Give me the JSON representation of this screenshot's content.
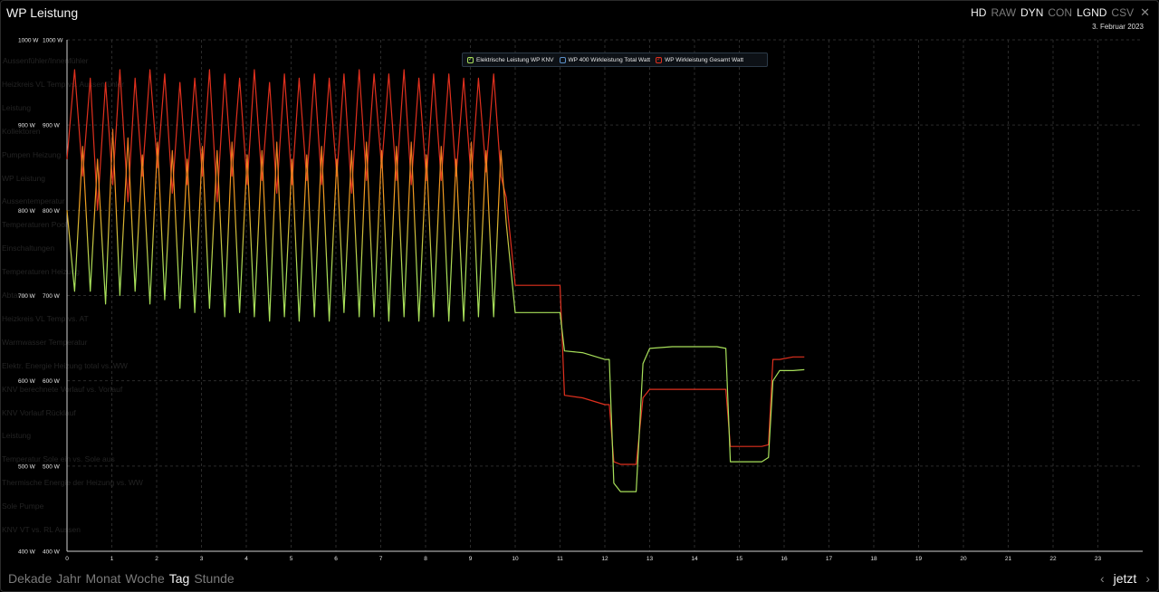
{
  "title": "WP Leistung",
  "top_buttons": [
    {
      "label": "HD",
      "active": true
    },
    {
      "label": "RAW",
      "active": false
    },
    {
      "label": "DYN",
      "active": true
    },
    {
      "label": "CON",
      "active": false
    },
    {
      "label": "LGND",
      "active": true
    },
    {
      "label": "CSV",
      "active": false
    }
  ],
  "close_icon": "close-icon",
  "date": "3. Februar 2023",
  "ghost_menu": [
    "Aussenfühler/Innenfühler",
    "Heizkreis VL Temp vs. Aussenfühler",
    "Leistung",
    "Kollektoren",
    "Pumpen Heizung",
    "WP Leistung",
    "Aussentemperatur",
    "Temperaturen Pool",
    "Einschaltungen",
    "Temperaturen Heizung",
    "Abtauen",
    "Heizkreis VL Temp vs. AT",
    "Warmwasser Temperatur",
    "Elektr. Energie Heizung total vs. WW",
    "KNV berechnete Vorlauf vs. Vorlauf",
    "KNV Vorlauf Rücklauf",
    "Leistung",
    "Temperatur Sole ein vs. Sole aus",
    "Thermische Energie der Heizung vs. WW",
    "Sole Pumpe",
    "KNV VT vs. RL Aussen"
  ],
  "legend": [
    {
      "name": "Elektrische Leistung WP KNV",
      "color": "#a8e05a",
      "checked": true
    },
    {
      "name": "WP 400 Wirkleistung Total Watt",
      "color": "#5b8fc7",
      "checked": false
    },
    {
      "name": "WP Wirkleistung Gesamt Watt",
      "color": "#e0301e",
      "checked": true
    }
  ],
  "bottom_nav": [
    {
      "label": "Dekade",
      "active": false
    },
    {
      "label": "Jahr",
      "active": false
    },
    {
      "label": "Monat",
      "active": false
    },
    {
      "label": "Woche",
      "active": false
    },
    {
      "label": "Tag",
      "active": true
    },
    {
      "label": "Stunde",
      "active": false
    }
  ],
  "nav": {
    "prev_icon": "chevron-left-icon",
    "now_label": "jetzt",
    "next_icon": "chevron-right-icon"
  },
  "chart_data": {
    "type": "line",
    "xlim": [
      0,
      24
    ],
    "ylim": [
      400,
      1000
    ],
    "x_ticks": [
      "0",
      "1",
      "2",
      "3",
      "4",
      "5",
      "6",
      "7",
      "8",
      "9",
      "10",
      "11",
      "12",
      "13",
      "14",
      "15",
      "16",
      "17",
      "18",
      "19",
      "20",
      "21",
      "22",
      "23"
    ],
    "y_ticks": [
      "1000 W",
      "900 W",
      "800 W",
      "700 W",
      "600 W",
      "500 W",
      "400 W"
    ],
    "y_tick_values": [
      1000,
      900,
      800,
      700,
      600,
      500,
      400
    ],
    "grid": true,
    "legend_position": "top-center",
    "series": [
      {
        "name": "Elektrische Leistung WP KNV",
        "color": "#a8e05a",
        "gradient_top": "#e0301e",
        "x": [
          0,
          0.17,
          0.35,
          0.52,
          0.68,
          0.86,
          1.02,
          1.18,
          1.36,
          1.52,
          1.68,
          1.85,
          2.02,
          2.18,
          2.35,
          2.52,
          2.68,
          2.85,
          3.02,
          3.18,
          3.35,
          3.52,
          3.68,
          3.85,
          4.02,
          4.18,
          4.35,
          4.52,
          4.68,
          4.85,
          5.02,
          5.18,
          5.35,
          5.52,
          5.68,
          5.85,
          6.02,
          6.18,
          6.35,
          6.52,
          6.68,
          6.85,
          7.02,
          7.18,
          7.35,
          7.52,
          7.68,
          7.85,
          8.02,
          8.18,
          8.35,
          8.52,
          8.68,
          8.85,
          9.02,
          9.18,
          9.35,
          9.52,
          9.68,
          9.8,
          10,
          10.5,
          11,
          11.1,
          11.5,
          12,
          12.1,
          12.2,
          12.35,
          12.5,
          12.7,
          12.85,
          13,
          13.5,
          14,
          14.5,
          14.7,
          14.8,
          15.1,
          15.5,
          15.65,
          15.75,
          15.9,
          16.2,
          16.45
        ],
        "y": [
          800,
          705,
          875,
          705,
          860,
          690,
          895,
          700,
          885,
          705,
          865,
          690,
          880,
          695,
          870,
          685,
          860,
          680,
          875,
          685,
          870,
          675,
          880,
          680,
          865,
          675,
          870,
          670,
          880,
          675,
          860,
          670,
          865,
          675,
          875,
          670,
          860,
          680,
          870,
          675,
          880,
          675,
          870,
          670,
          875,
          675,
          880,
          670,
          865,
          675,
          875,
          670,
          860,
          670,
          880,
          675,
          870,
          675,
          870,
          785,
          680,
          680,
          680,
          635,
          633,
          625,
          625,
          480,
          470,
          470,
          470,
          620,
          638,
          640,
          640,
          640,
          638,
          505,
          505,
          505,
          510,
          600,
          612,
          612,
          613
        ]
      },
      {
        "name": "WP Wirkleistung Gesamt Watt",
        "color": "#e0301e",
        "x": [
          0,
          0.17,
          0.35,
          0.52,
          0.68,
          0.86,
          1.02,
          1.18,
          1.36,
          1.52,
          1.68,
          1.85,
          2.02,
          2.18,
          2.35,
          2.52,
          2.68,
          2.85,
          3.02,
          3.18,
          3.35,
          3.52,
          3.68,
          3.85,
          4.02,
          4.18,
          4.35,
          4.52,
          4.68,
          4.85,
          5.02,
          5.18,
          5.35,
          5.52,
          5.68,
          5.85,
          6.02,
          6.18,
          6.35,
          6.52,
          6.68,
          6.85,
          7.02,
          7.18,
          7.35,
          7.52,
          7.68,
          7.85,
          8.02,
          8.18,
          8.35,
          8.52,
          8.68,
          8.85,
          9.02,
          9.18,
          9.35,
          9.52,
          9.68,
          9.8,
          10,
          10.5,
          11,
          11.1,
          11.5,
          12,
          12.1,
          12.2,
          12.35,
          12.5,
          12.7,
          12.85,
          13,
          13.5,
          14,
          14.5,
          14.7,
          14.8,
          15.1,
          15.5,
          15.65,
          15.75,
          15.9,
          16.2,
          16.45
        ],
        "y": [
          860,
          965,
          840,
          955,
          800,
          950,
          830,
          965,
          810,
          955,
          840,
          965,
          850,
          960,
          820,
          950,
          830,
          955,
          840,
          965,
          810,
          960,
          840,
          955,
          830,
          965,
          835,
          950,
          820,
          960,
          830,
          955,
          835,
          960,
          830,
          955,
          840,
          960,
          820,
          965,
          835,
          960,
          850,
          960,
          835,
          965,
          830,
          955,
          835,
          960,
          835,
          960,
          840,
          955,
          835,
          955,
          845,
          960,
          840,
          815,
          712,
          712,
          712,
          583,
          580,
          572,
          572,
          505,
          502,
          502,
          502,
          580,
          590,
          590,
          590,
          590,
          590,
          523,
          523,
          523,
          525,
          625,
          625,
          628,
          628
        ]
      }
    ]
  }
}
